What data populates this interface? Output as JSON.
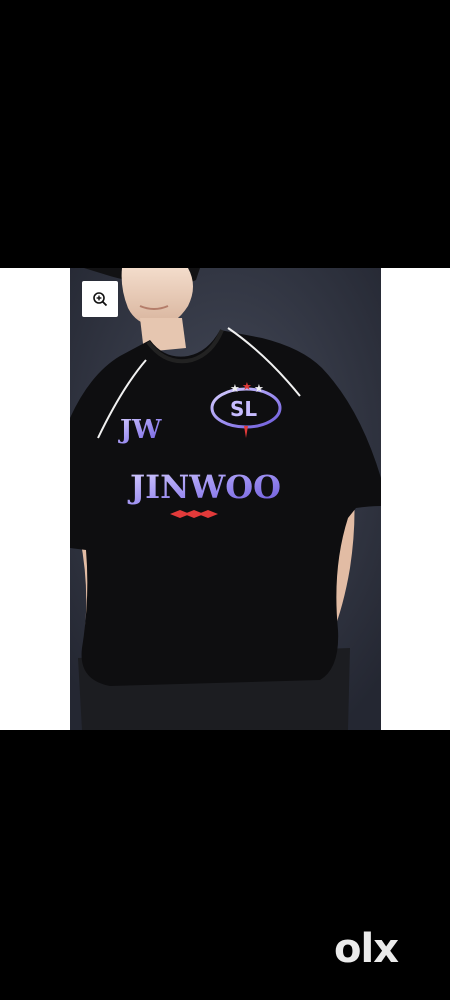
{
  "viewer": {
    "zoom_icon": "zoom-in-icon",
    "watermark": "olx"
  },
  "shirt_print": {
    "chest_monogram": "JW",
    "badge_text": "SL",
    "main_text": "JINWOO"
  },
  "colors": {
    "background": "#000000",
    "image_backdrop": "#ffffff",
    "photo_backdrop": "#2e3240",
    "shirt": "#0e0e10",
    "print_purple": "#9a8cf0",
    "accent_red": "#e23a3a"
  }
}
